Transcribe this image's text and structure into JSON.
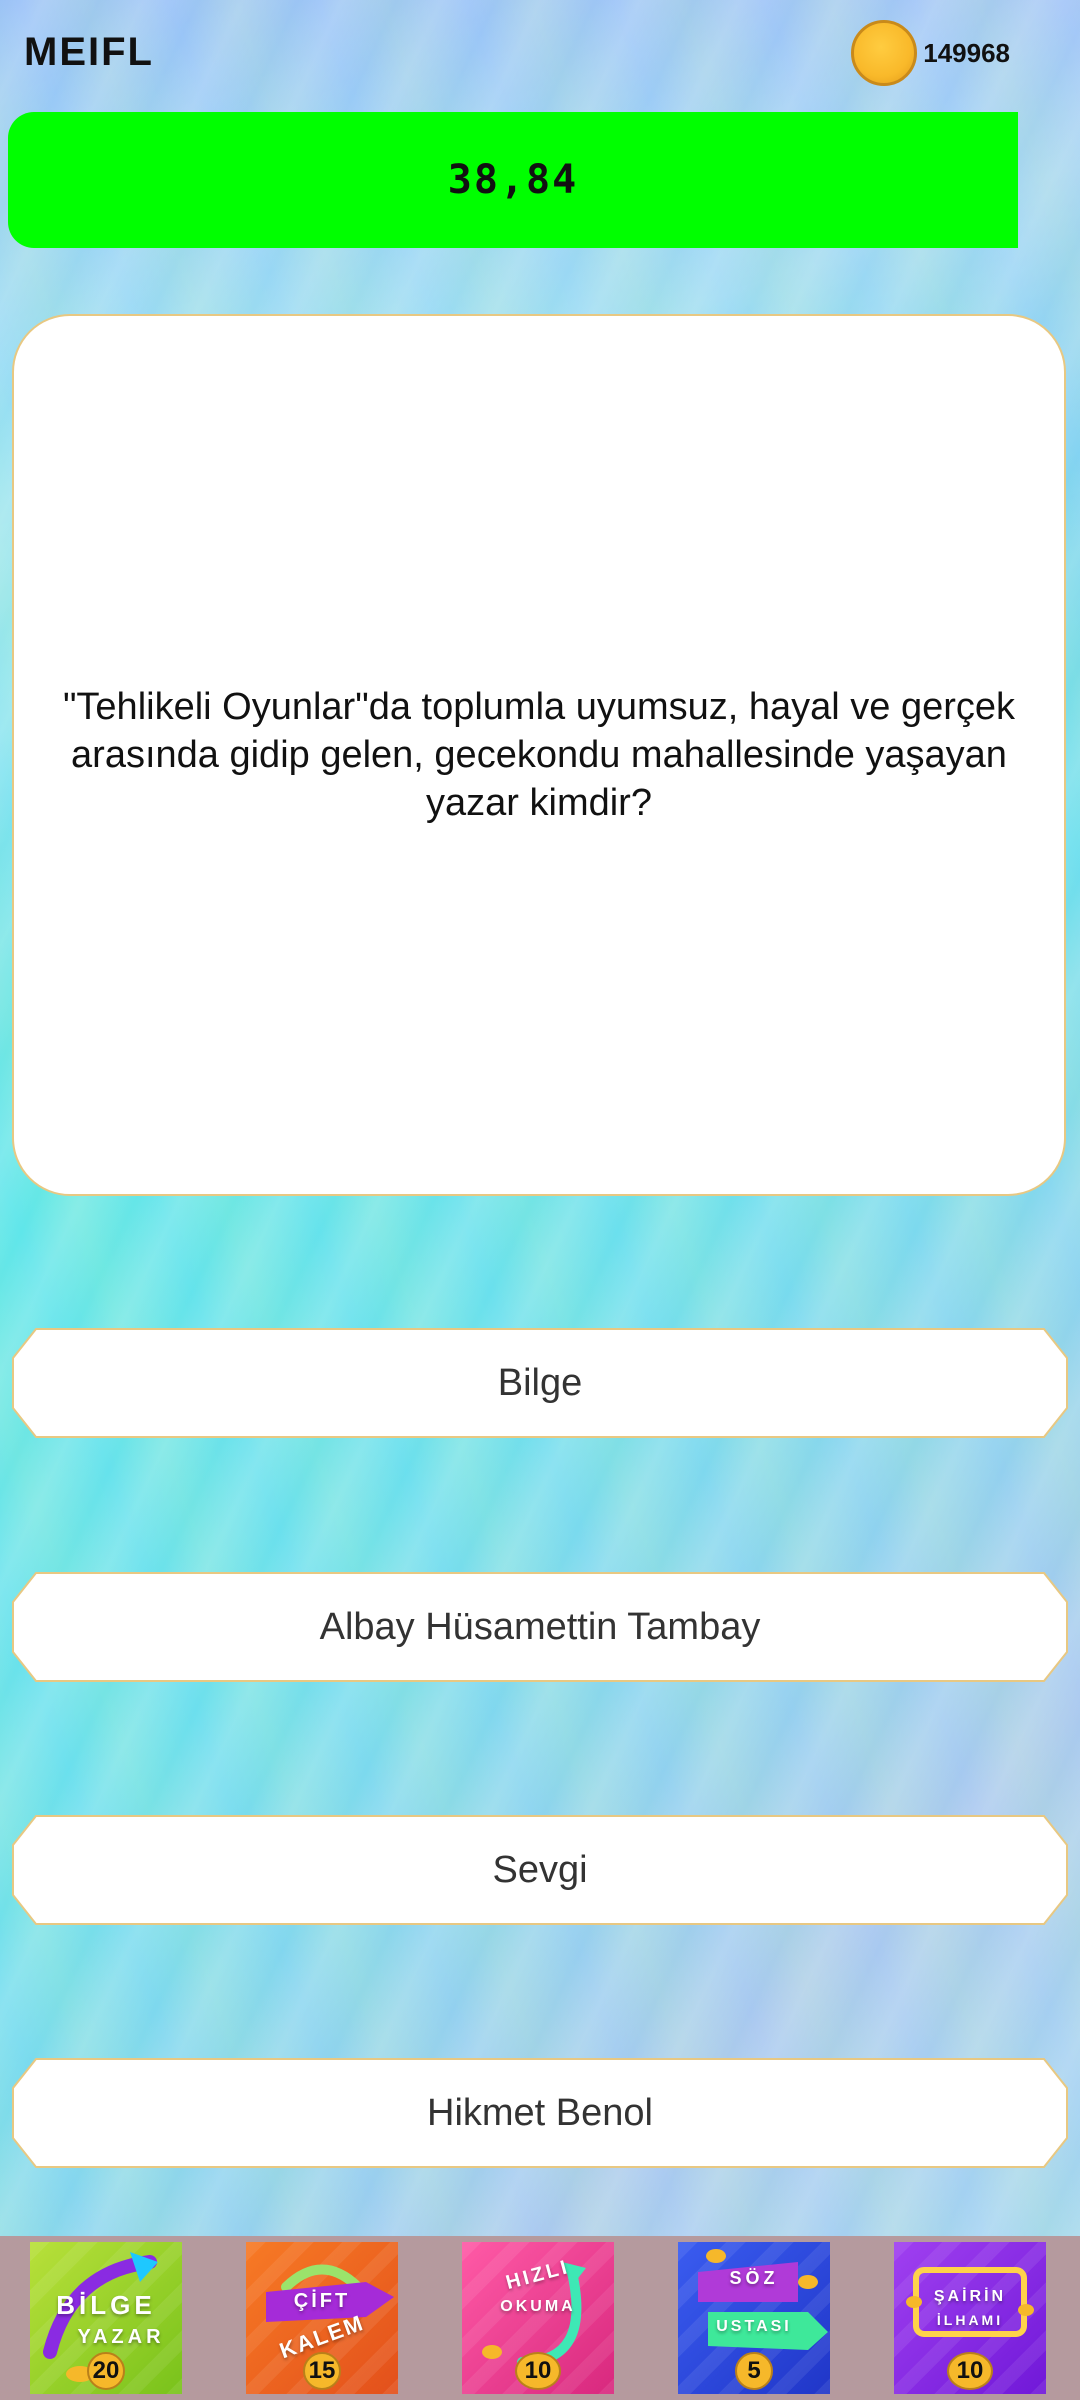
{
  "header": {
    "app_title": "MEIFL",
    "coin_count": "149968"
  },
  "timer": {
    "value": "38,84",
    "color": "#00ff00"
  },
  "question": {
    "text": "\"Tehlikeli Oyunlar\"da toplumla uyumsuz, hayal ve gerçek arasında gidip gelen, gecekondu mahallesinde yaşayan yazar kimdir?"
  },
  "answers": [
    {
      "label": "Bilge"
    },
    {
      "label": "Albay Hüsamettin Tambay"
    },
    {
      "label": "Sevgi"
    },
    {
      "label": "Hikmet Benol"
    }
  ],
  "jokers": [
    {
      "lines": [
        "BİLGE",
        "YAZAR"
      ],
      "count": "20",
      "icon": "bilge-yazar-icon"
    },
    {
      "lines": [
        "ÇİFT",
        "KALEM"
      ],
      "count": "15",
      "icon": "cift-kalem-icon"
    },
    {
      "lines": [
        "HIZLI",
        "OKUMA"
      ],
      "count": "10",
      "icon": "hizli-okuma-icon"
    },
    {
      "lines": [
        "SÖZ",
        "USTASI"
      ],
      "count": "5",
      "icon": "soz-ustasi-icon"
    },
    {
      "lines": [
        "ŞAİRİN",
        "İLHAMI"
      ],
      "count": "10",
      "icon": "sairin-ilhami-icon"
    }
  ]
}
